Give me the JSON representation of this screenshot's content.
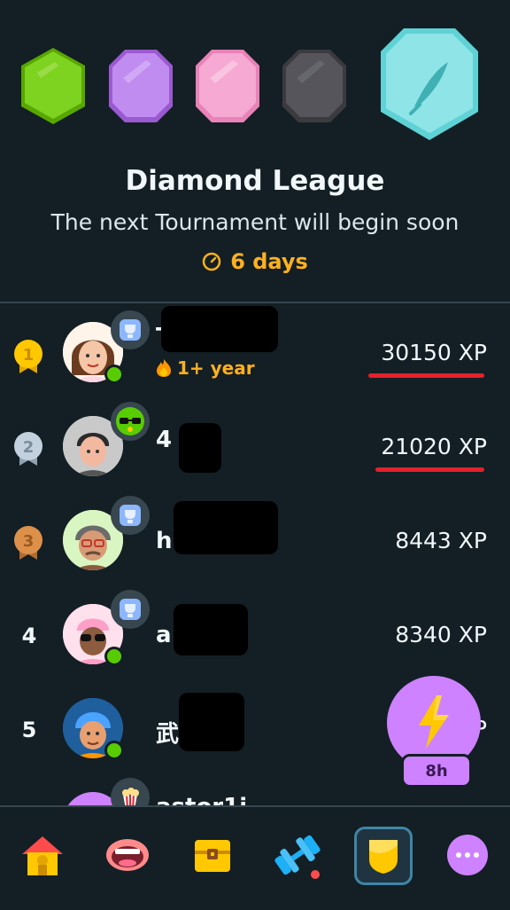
{
  "league": {
    "title": "Diamond League",
    "subtitle": "The next Tournament will begin soon",
    "countdown": "6 days",
    "badges": [
      "emerald",
      "amethyst",
      "pearl",
      "obsidian",
      "diamond"
    ]
  },
  "leaderboard": [
    {
      "rank": "1",
      "name": "T",
      "streak": "1+ year",
      "xp": "30150 XP",
      "medal": "gold"
    },
    {
      "rank": "2",
      "name": "4",
      "streak": "",
      "xp": "21020 XP",
      "medal": "silver"
    },
    {
      "rank": "3",
      "name": "h",
      "streak": "",
      "xp": "8443 XP",
      "medal": "bronze"
    },
    {
      "rank": "4",
      "name": "a",
      "streak": "",
      "xp": "8340 XP",
      "medal": ""
    },
    {
      "rank": "5",
      "name": "武",
      "streak": "",
      "xp": "P",
      "medal": ""
    },
    {
      "rank": "",
      "name": "astor1i",
      "streak": "",
      "xp": "",
      "medal": ""
    }
  ],
  "boost": {
    "timer": "8h"
  },
  "nav": [
    "home-icon",
    "speak-icon",
    "treasure-chest-icon",
    "dumbbell-icon",
    "shield-icon",
    "more-icon"
  ],
  "colors": {
    "accent": "#ffb020",
    "background": "#131f24",
    "highlight": "#e3202b",
    "online": "#58cc02"
  }
}
